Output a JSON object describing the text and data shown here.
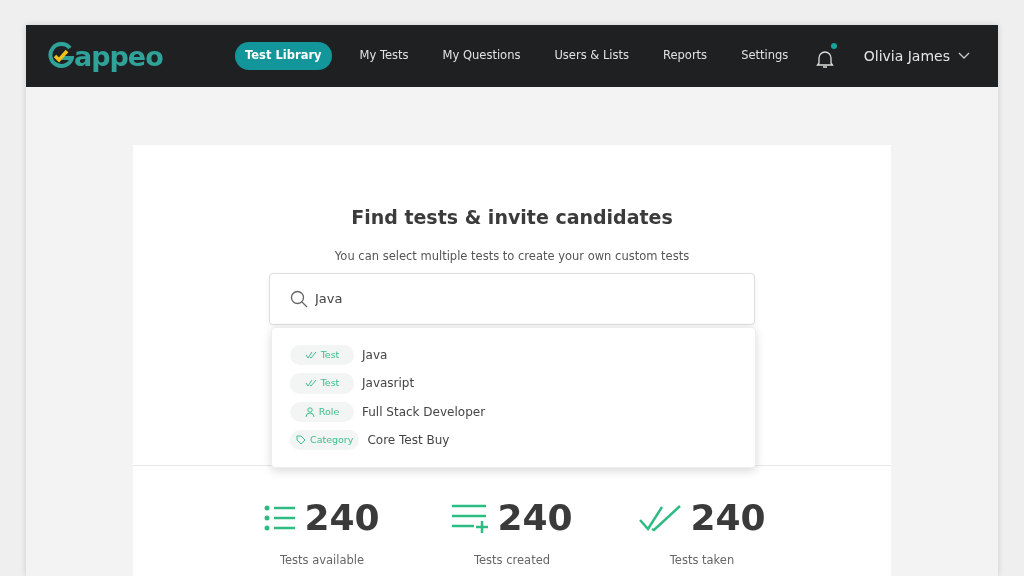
{
  "navbar": {
    "logo": "appeo",
    "tabs": [
      {
        "label": "Test Library",
        "selected": true
      },
      {
        "label": "My Tests",
        "selected": false
      },
      {
        "label": "My Questions",
        "selected": false
      },
      {
        "label": "Users  & Lists",
        "selected": false
      },
      {
        "label": "Reports",
        "selected": false
      },
      {
        "label": "Settings",
        "selected": false
      }
    ],
    "notification_unread": true,
    "user": "Olivia James"
  },
  "hero": {
    "title": "Find tests & invite candidates",
    "subtitle": "You can select multiple tests to create your own custom tests"
  },
  "search": {
    "value": "Java"
  },
  "suggestions": [
    {
      "kind": "test",
      "tag": "Test",
      "label": "Java"
    },
    {
      "kind": "test",
      "tag": "Test",
      "label": "Javasript"
    },
    {
      "kind": "role",
      "tag": "Role",
      "label": "Full Stack Developer"
    },
    {
      "kind": "category",
      "tag": "Category",
      "label": "Core Test Buy"
    }
  ],
  "stats": [
    {
      "kind": "available",
      "value": "240",
      "label": "Tests available"
    },
    {
      "kind": "created",
      "value": "240",
      "label": "Tests created"
    },
    {
      "kind": "taken",
      "value": "240",
      "label": "Tests taken"
    }
  ]
}
